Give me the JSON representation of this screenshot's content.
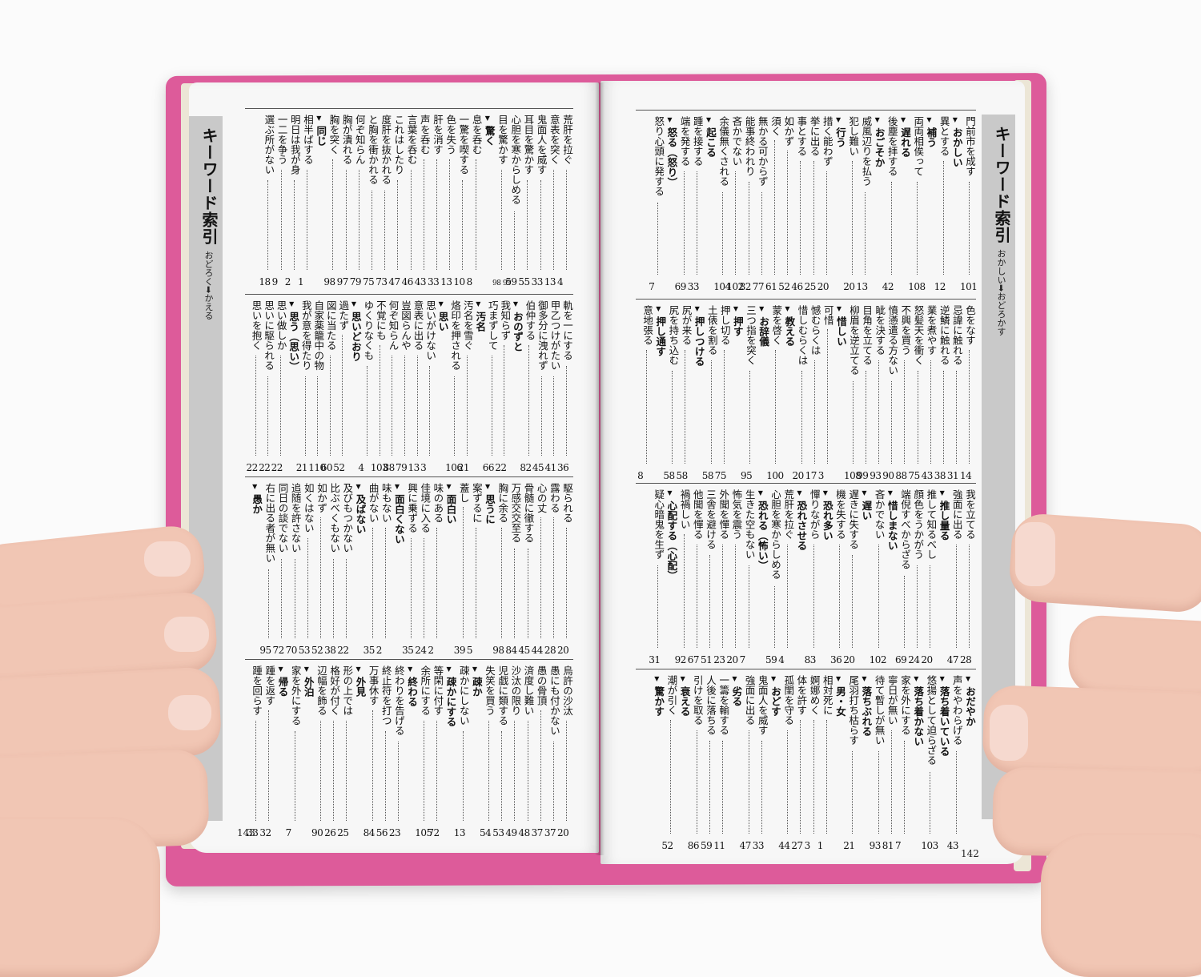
{
  "book": {
    "left_page": {
      "tab_title": "キーワード索引",
      "tab_range": "おどろく➡かえる",
      "folio": "143",
      "blocks": [
        [
          {
            "text": "荒肝を拉ぐ",
            "pages": "4"
          },
          {
            "text": "意表を突く",
            "pages": "13"
          },
          {
            "text": "鬼面人を威す",
            "pages": "33"
          },
          {
            "text": "耳目を驚かす",
            "pages": "55"
          },
          {
            "text": "心胆を寒からしめる",
            "pages": "59"
          },
          {
            "text": "目を驚かす",
            "pages": "98 99"
          },
          {
            "head": "驚く"
          },
          {
            "text": "息を呑む",
            "pages": "8"
          },
          {
            "text": "一驚を喫する",
            "pages": "10"
          },
          {
            "text": "色を失う",
            "pages": "13"
          },
          {
            "text": "肝を消す",
            "pages": "33"
          },
          {
            "text": "声を呑む",
            "pages": "43"
          },
          {
            "text": "言葉を呑む",
            "pages": "46"
          },
          {
            "text": "これはしたり",
            "pages": "47"
          },
          {
            "text": "度肝を抜かれる",
            "pages": "73"
          },
          {
            "text": "と胸を衝かれる",
            "pages": "75"
          },
          {
            "text": "何ぞ知らん",
            "pages": "79"
          },
          {
            "text": "胸が潰れる",
            "pages": "97"
          },
          {
            "text": "胸を突く",
            "pages": "98"
          },
          {
            "head": "同じ"
          },
          {
            "text": "相半ばする",
            "pages": "1"
          },
          {
            "text": "明日は我が身",
            "pages": "2"
          },
          {
            "text": "一二を争う",
            "pages": "9"
          },
          {
            "text": "選ぶ所がない",
            "pages": "18"
          }
        ],
        [
          {
            "text": "軌を一にする",
            "pages": "36"
          },
          {
            "text": "甲乙つけがたい",
            "pages": "41"
          },
          {
            "text": "御多分に洩れず",
            "pages": "45"
          },
          {
            "text": "伯仲する",
            "pages": "82"
          },
          {
            "head": "おのずと"
          },
          {
            "text": "我知らず",
            "pages": "22"
          },
          {
            "text": "巧まずして",
            "pages": "66"
          },
          {
            "head": "汚名"
          },
          {
            "text": "汚名を雪ぐ",
            "pages": "21"
          },
          {
            "text": "烙印を押される",
            "pages": "106"
          },
          {
            "head": "思い"
          },
          {
            "text": "思いがけない",
            "pages": "3"
          },
          {
            "text": "意表に出る",
            "pages": "13"
          },
          {
            "text": "豈図らんや",
            "pages": "79"
          },
          {
            "text": "何ぞ知らん",
            "pages": "88"
          },
          {
            "text": "不覚にも",
            "pages": "103"
          },
          {
            "text": "ゆくりなくも",
            "pages": "4"
          },
          {
            "head": "思いどおり"
          },
          {
            "text": "過たず",
            "pages": "52"
          },
          {
            "text": "図に当たる",
            "pages": "60"
          },
          {
            "text": "自家薬籠中の物",
            "pages": "110"
          },
          {
            "text": "我が意を得たり",
            "pages": "21"
          },
          {
            "head": "思う（思い）"
          },
          {
            "text": "思い做しか",
            "pages": "22"
          },
          {
            "text": "思いに駆られる",
            "pages": "22"
          },
          {
            "text": "思いを抱く",
            "pages": "22"
          }
        ],
        [
          {
            "text": "駆られる",
            "pages": "20"
          },
          {
            "text": "露わる",
            "pages": "28"
          },
          {
            "text": "心の丈",
            "pages": "44"
          },
          {
            "text": "骨髄に徹する",
            "pages": "45"
          },
          {
            "text": "万感交交至る",
            "pages": "84"
          },
          {
            "text": "胸に余る",
            "pages": "98"
          },
          {
            "head": "思うに"
          },
          {
            "text": "案ずるに",
            "pages": "5"
          },
          {
            "text": "蓋し",
            "pages": "39"
          },
          {
            "head": "面白い"
          },
          {
            "text": "味のある",
            "pages": "2"
          },
          {
            "text": "佳境に入る",
            "pages": "24"
          },
          {
            "text": "興に乗ずる",
            "pages": "35"
          },
          {
            "head": "面白くない"
          },
          {
            "text": "味もない",
            "pages": "2"
          },
          {
            "text": "曲がない",
            "pages": "35"
          },
          {
            "head": "及ばない"
          },
          {
            "text": "及びもつかない",
            "pages": "22"
          },
          {
            "text": "比ぶべくもない",
            "pages": "38"
          },
          {
            "text": "如かず",
            "pages": "52"
          },
          {
            "text": "如くはない",
            "pages": "53"
          },
          {
            "text": "追随を許さない",
            "pages": "70"
          },
          {
            "text": "同日の談でない",
            "pages": "72"
          },
          {
            "text": "右に出る者が無い",
            "pages": "95"
          },
          {
            "head": "愚か"
          }
        ],
        [
          {
            "text": "烏許の沙汰",
            "pages": "20"
          },
          {
            "text": "愚にも付かない",
            "pages": "37"
          },
          {
            "text": "愚の骨頂",
            "pages": "37"
          },
          {
            "text": "済度し難い",
            "pages": "48"
          },
          {
            "text": "沙汰の限り",
            "pages": "49"
          },
          {
            "text": "児戯に類する",
            "pages": "53"
          },
          {
            "text": "失笑を買う",
            "pages": "54"
          },
          {
            "head": "疎か"
          },
          {
            "text": "疎かにしない",
            "pages": "13"
          },
          {
            "head": "疎かにする"
          },
          {
            "text": "等閑に付す",
            "pages": "72"
          },
          {
            "text": "余所にする",
            "pages": "105"
          },
          {
            "head": "終わる"
          },
          {
            "text": "終わりを告げる",
            "pages": "23"
          },
          {
            "text": "終止符を打つ",
            "pages": "56"
          },
          {
            "text": "万事休す",
            "pages": "84"
          },
          {
            "head": "外見"
          },
          {
            "text": "形の上では",
            "pages": "25"
          },
          {
            "text": "格好が付く",
            "pages": "26"
          },
          {
            "text": "辺幅を飾る",
            "pages": "90"
          },
          {
            "head": "外泊"
          },
          {
            "text": "家を外にする",
            "pages": "7"
          },
          {
            "head": "帰る"
          },
          {
            "text": "踵を返す",
            "pages": "32"
          },
          {
            "text": "踵を回らす",
            "pages": "33"
          }
        ]
      ]
    },
    "right_page": {
      "tab_title": "キーワード索引",
      "tab_range": "おかしい➡おどろかす",
      "folio": "142",
      "blocks": [
        [
          {
            "text": "門前市を成す",
            "pages": "101"
          },
          {
            "head": "おかしい"
          },
          {
            "text": "異とする",
            "pages": "12"
          },
          {
            "head": "補う"
          },
          {
            "text": "両両相俟って",
            "pages": "108"
          },
          {
            "head": "遅れる"
          },
          {
            "text": "後塵を拝する",
            "pages": "42"
          },
          {
            "head": "おごそか"
          },
          {
            "text": "威風辺りを払う",
            "pages": "13"
          },
          {
            "text": "犯し難い",
            "pages": "20"
          },
          {
            "head": "行う"
          },
          {
            "text": "措く能わず",
            "pages": "20"
          },
          {
            "text": "挙に出る",
            "pages": "25"
          },
          {
            "text": "事とする",
            "pages": "46"
          },
          {
            "text": "如かず",
            "pages": "52"
          },
          {
            "text": "須く",
            "pages": "61"
          },
          {
            "text": "無かる可からず",
            "pages": "77"
          },
          {
            "text": "能事終われり",
            "pages": "82"
          },
          {
            "text": "吝かでない",
            "pages": "102"
          },
          {
            "text": "余儀無くされる",
            "pages": "104"
          },
          {
            "head": "起こる"
          },
          {
            "text": "踵を接する",
            "pages": "33"
          },
          {
            "text": "端を発する",
            "pages": "69"
          },
          {
            "head": "怒る（怒り）"
          },
          {
            "text": "怒り心頭に発する",
            "pages": "7"
          }
        ],
        [
          {
            "text": "色をなす",
            "pages": "14"
          },
          {
            "text": "忌諱に触れる",
            "pages": "31"
          },
          {
            "text": "逆鱗に触れる",
            "pages": "38"
          },
          {
            "text": "業を煮やす",
            "pages": "43"
          },
          {
            "text": "怒髪天を衝く",
            "pages": "75"
          },
          {
            "text": "不興を買う",
            "pages": "88"
          },
          {
            "text": "憤懣遣る方ない",
            "pages": "90"
          },
          {
            "text": "眦を決する",
            "pages": "93"
          },
          {
            "text": "目角を立てる",
            "pages": "99"
          },
          {
            "text": "柳眉を逆立てる",
            "pages": "108"
          },
          {
            "head": "惜しい"
          },
          {
            "text": "可惜",
            "pages": "3"
          },
          {
            "text": "憾むらくは",
            "pages": "17"
          },
          {
            "text": "惜しむらくは",
            "pages": "20"
          },
          {
            "head": "教える"
          },
          {
            "text": "蒙を啓く",
            "pages": "100"
          },
          {
            "head": "お辞儀"
          },
          {
            "text": "三つ指を突く",
            "pages": "95"
          },
          {
            "head": "押す"
          },
          {
            "text": "押し切る",
            "pages": "75"
          },
          {
            "text": "土俵を割る",
            "pages": "58"
          },
          {
            "head": "押しつける"
          },
          {
            "text": "尻が来る",
            "pages": "58"
          },
          {
            "text": "尻を持ち込む",
            "pages": "58"
          },
          {
            "head": "押し通す"
          },
          {
            "text": "意地張る",
            "pages": "8"
          }
        ],
        [
          {
            "text": "我を立てる",
            "pages": "28"
          },
          {
            "text": "強面に出る",
            "pages": "47"
          },
          {
            "head": "推し量る"
          },
          {
            "text": "推して知るべし",
            "pages": "20"
          },
          {
            "text": "顔色をうかがう",
            "pages": "24"
          },
          {
            "text": "端倪すべからざる",
            "pages": "69"
          },
          {
            "head": "惜しまない"
          },
          {
            "text": "吝かでない",
            "pages": "102"
          },
          {
            "head": "遅い"
          },
          {
            "text": "遅きに失する",
            "pages": "20"
          },
          {
            "text": "機を失する",
            "pages": "36"
          },
          {
            "head": "恐れ多い"
          },
          {
            "text": "憚りながら",
            "pages": "83"
          },
          {
            "head": "恐れさせる"
          },
          {
            "text": "荒肝を拉ぐ",
            "pages": "4"
          },
          {
            "text": "心胆を寒からしめる",
            "pages": "59"
          },
          {
            "head": "恐れる（怖い）"
          },
          {
            "text": "生きた空もない",
            "pages": "7"
          },
          {
            "text": "怖気を震う",
            "pages": "20"
          },
          {
            "text": "外聞を憚る",
            "pages": "23"
          },
          {
            "text": "三舎を避ける",
            "pages": "51"
          },
          {
            "text": "他聞を憚る",
            "pages": "67"
          },
          {
            "text": "禍禍しい",
            "pages": "92"
          },
          {
            "head": "心配する（心配）"
          },
          {
            "text": "疑心暗鬼を生ず",
            "pages": "31"
          }
        ],
        [
          {
            "head": "おだやか"
          },
          {
            "text": "声をやわらげる",
            "pages": "43"
          },
          {
            "head": "落ち着いている"
          },
          {
            "text": "悠揚として迫らざる",
            "pages": "103"
          },
          {
            "head": "落ち着かない"
          },
          {
            "text": "家を外にする",
            "pages": "7"
          },
          {
            "text": "寧日が無い",
            "pages": "81"
          },
          {
            "text": "待て暫しが無い",
            "pages": "93"
          },
          {
            "head": "落ちぶれる"
          },
          {
            "text": "尾羽打ち枯らす",
            "pages": "21"
          },
          {
            "head": "男・女"
          },
          {
            "text": "相対死に",
            "pages": "1"
          },
          {
            "text": "婀娜めく",
            "pages": "3"
          },
          {
            "text": "体を許す",
            "pages": "27"
          },
          {
            "text": "孤閨を守る",
            "pages": "44"
          },
          {
            "head": "おどす"
          },
          {
            "text": "鬼面人を威す",
            "pages": "33"
          },
          {
            "text": "強面に出る",
            "pages": "47"
          },
          {
            "head": "劣る"
          },
          {
            "text": "一籌を輸する",
            "pages": "11"
          },
          {
            "text": "人後に落ちる",
            "pages": "59"
          },
          {
            "text": "引けを取る",
            "pages": "86"
          },
          {
            "head": "衰える"
          },
          {
            "text": "潮が引く",
            "pages": "52"
          },
          {
            "head": "驚かす"
          }
        ]
      ]
    }
  },
  "colors": {
    "cover": "#dd5b9a",
    "paper": "#f7f7f7",
    "tab": "#c9c9c9",
    "ink": "#111111",
    "skin": "#f1c6b4"
  }
}
